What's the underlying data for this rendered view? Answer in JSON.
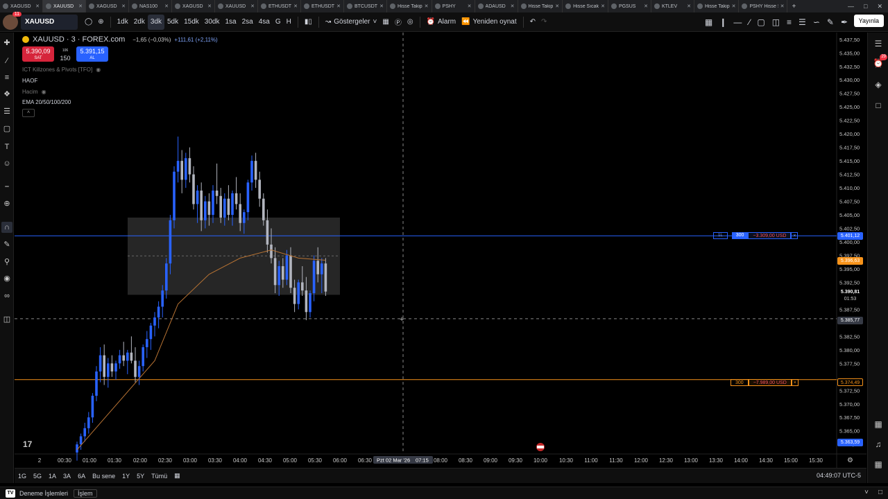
{
  "browser": {
    "tabs": [
      {
        "label": "XAGUSD",
        "active": false
      },
      {
        "label": "XAUUSD",
        "active": true
      },
      {
        "label": "XAGUSD",
        "active": false
      },
      {
        "label": "NAS100",
        "active": false
      },
      {
        "label": "XAGUSD",
        "active": false
      },
      {
        "label": "XAUUSD",
        "active": false
      },
      {
        "label": "ETHUSDT",
        "active": false
      },
      {
        "label": "ETHUSDT",
        "active": false
      },
      {
        "label": "BTCUSDT",
        "active": false
      },
      {
        "label": "Hisse Takip",
        "active": false
      },
      {
        "label": "PSHY",
        "active": false
      },
      {
        "label": "ADAUSD",
        "active": false
      },
      {
        "label": "Hisse Takip",
        "active": false
      },
      {
        "label": "Hisse Sıcak",
        "active": false
      },
      {
        "label": "PGSUS",
        "active": false
      },
      {
        "label": "KTLEV",
        "active": false
      },
      {
        "label": "Hisse Takip",
        "active": false
      },
      {
        "label": "PSHY Hisse Se",
        "active": false
      }
    ],
    "new_tab": "+"
  },
  "toolbar": {
    "notifications": "11",
    "symbol": "XAUUSD",
    "intervals": [
      "1dk",
      "2dk",
      "3dk",
      "5dk",
      "15dk",
      "30dk",
      "1sa",
      "2sa",
      "4sa",
      "G",
      "H"
    ],
    "selected_interval": "3dk",
    "indicators_label": "Göstergeler",
    "alarm_label": "Alarm",
    "replay_label": "Yeniden oynat",
    "publish_label": "Yayınla"
  },
  "legend": {
    "title": "XAUUSD · 3 · FOREX.com",
    "change": "−1,65 (−0,03%)",
    "change2": "+111,61 (+2,11%)",
    "sell_price": "5.390,09",
    "sell_label": "SAT",
    "spread_top": "106",
    "spread_qty": "150",
    "buy_price": "5.391,15",
    "buy_label": "AL",
    "indicator1": "ICT Killzones & Pivots [TFO]",
    "indicator2": "HAOF",
    "indicator3": "Hacim",
    "indicator4": "EMA 20/50/100/200"
  },
  "orders": [
    {
      "side_tag": "1L",
      "qty": "300",
      "pnl": "−3.309,00 USD",
      "close": "×",
      "price_tag": "5.401,12",
      "color": "#2962ff"
    },
    {
      "qty": "300",
      "pnl": "−7.989,00 USD",
      "close": "×",
      "price_tag": "5.374,49",
      "color": "#f7931a"
    }
  ],
  "price_axis": {
    "ticks": [
      "5.437,50",
      "5.435,00",
      "5.432,50",
      "5.430,00",
      "5.427,50",
      "5.425,00",
      "5.422,50",
      "5.420,00",
      "5.417,50",
      "5.415,00",
      "5.412,50",
      "5.410,00",
      "5.407,50",
      "5.405,00",
      "5.402,50",
      "5.400,00",
      "5.397,50",
      "5.395,00",
      "5.392,50",
      "5.387,50",
      "5.382,50",
      "5.380,00",
      "5.377,50",
      "5.372,50",
      "5.370,00",
      "5.367,50",
      "5.365,00",
      "5.362,50"
    ],
    "ema_tag": "5.396,63",
    "last_price": "5.390,81",
    "countdown": "01:53",
    "crosshair_price": "5.385,77",
    "low_tag": "5.363,59"
  },
  "time_axis": {
    "labels": [
      "2",
      "00:30",
      "01:00",
      "01:30",
      "02:00",
      "02:30",
      "03:00",
      "03:30",
      "04:00",
      "04:30",
      "05:00",
      "05:30",
      "06:00",
      "06:30",
      "08:00",
      "08:30",
      "09:00",
      "09:30",
      "10:00",
      "10:30",
      "11:00",
      "11:30",
      "12:00",
      "12:30",
      "13:00",
      "13:30",
      "14:00",
      "14:30",
      "15:00",
      "15:30"
    ],
    "crosshair_date": "Pzt 02 Mar '26",
    "crosshair_time": "07:15"
  },
  "range_bar": {
    "ranges": [
      "1G",
      "5G",
      "1A",
      "3A",
      "6A",
      "Bu sene",
      "1Y",
      "5Y",
      "Tümü"
    ],
    "clock": "04:49:07 UTC-5"
  },
  "bottom_bar": {
    "tab1": "Deneme İşlemleri",
    "tab2": "İşlem"
  },
  "colors": {
    "up": "#2962ff",
    "down": "#b2b5be",
    "ema": "#b87333",
    "box": "#2a2a2a"
  },
  "chart_data": {
    "type": "candlestick",
    "ylim": [
      5361.5,
      5438.5
    ],
    "time_labels_note": "",
    "candles": [
      [
        5361.0,
        5363.0,
        5359.5,
        5362.5
      ],
      [
        5362.5,
        5364.5,
        5361.5,
        5364.0
      ],
      [
        5364.0,
        5366.5,
        5363.0,
        5365.5
      ],
      [
        5365.5,
        5368.5,
        5364.5,
        5367.5
      ],
      [
        5367.5,
        5372.0,
        5366.5,
        5371.5
      ],
      [
        5371.5,
        5377.0,
        5370.5,
        5376.0
      ],
      [
        5376.0,
        5380.5,
        5374.0,
        5379.0
      ],
      [
        5379.0,
        5381.0,
        5373.5,
        5375.0
      ],
      [
        5375.0,
        5378.5,
        5373.0,
        5377.5
      ],
      [
        5377.5,
        5379.0,
        5375.0,
        5376.0
      ],
      [
        5376.0,
        5378.0,
        5374.5,
        5377.5
      ],
      [
        5377.5,
        5380.0,
        5376.5,
        5379.0
      ],
      [
        5379.0,
        5381.5,
        5377.0,
        5378.0
      ],
      [
        5378.0,
        5380.0,
        5375.5,
        5379.5
      ],
      [
        5379.5,
        5382.5,
        5377.5,
        5378.0
      ],
      [
        5378.0,
        5380.5,
        5374.0,
        5375.0
      ],
      [
        5375.0,
        5378.0,
        5373.5,
        5377.0
      ],
      [
        5377.0,
        5381.0,
        5376.0,
        5380.5
      ],
      [
        5380.5,
        5383.5,
        5378.5,
        5382.0
      ],
      [
        5382.0,
        5385.0,
        5380.0,
        5384.5
      ],
      [
        5384.5,
        5387.0,
        5382.5,
        5386.0
      ],
      [
        5386.0,
        5389.0,
        5384.0,
        5388.0
      ],
      [
        5388.0,
        5392.0,
        5386.0,
        5391.0
      ],
      [
        5391.0,
        5397.0,
        5389.5,
        5396.0
      ],
      [
        5396.0,
        5405.0,
        5394.0,
        5404.0
      ],
      [
        5404.0,
        5414.0,
        5402.5,
        5413.0
      ],
      [
        5413.0,
        5419.5,
        5411.0,
        5415.0
      ],
      [
        5415.0,
        5417.0,
        5409.0,
        5411.5
      ],
      [
        5411.5,
        5416.5,
        5410.0,
        5415.5
      ],
      [
        5415.5,
        5417.5,
        5411.0,
        5412.5
      ],
      [
        5412.5,
        5414.0,
        5406.0,
        5407.0
      ],
      [
        5407.0,
        5410.5,
        5403.5,
        5409.5
      ],
      [
        5409.5,
        5411.0,
        5402.0,
        5404.0
      ],
      [
        5404.0,
        5408.5,
        5402.5,
        5407.5
      ],
      [
        5407.5,
        5409.0,
        5403.0,
        5405.0
      ],
      [
        5405.0,
        5410.5,
        5403.5,
        5409.5
      ],
      [
        5409.5,
        5414.5,
        5407.0,
        5408.5
      ],
      [
        5408.5,
        5410.0,
        5403.5,
        5404.5
      ],
      [
        5404.5,
        5409.0,
        5403.0,
        5408.0
      ],
      [
        5408.0,
        5410.5,
        5404.0,
        5405.0
      ],
      [
        5405.0,
        5409.5,
        5403.0,
        5409.0
      ],
      [
        5409.0,
        5412.0,
        5406.0,
        5407.0
      ],
      [
        5407.0,
        5409.0,
        5402.0,
        5403.5
      ],
      [
        5403.5,
        5406.0,
        5401.5,
        5405.5
      ],
      [
        5405.5,
        5411.5,
        5404.0,
        5411.0
      ],
      [
        5411.0,
        5416.0,
        5409.5,
        5415.0
      ],
      [
        5415.0,
        5416.5,
        5410.0,
        5411.5
      ],
      [
        5411.5,
        5413.0,
        5406.5,
        5408.0
      ],
      [
        5408.0,
        5409.0,
        5403.0,
        5404.0
      ],
      [
        5404.0,
        5406.0,
        5398.0,
        5399.5
      ],
      [
        5399.5,
        5402.5,
        5396.0,
        5397.0
      ],
      [
        5397.0,
        5399.0,
        5390.5,
        5392.0
      ],
      [
        5392.0,
        5396.5,
        5390.0,
        5395.5
      ],
      [
        5395.5,
        5397.0,
        5391.5,
        5393.0
      ],
      [
        5393.0,
        5398.5,
        5392.0,
        5397.5
      ],
      [
        5397.5,
        5399.0,
        5390.5,
        5391.5
      ],
      [
        5391.5,
        5393.0,
        5387.0,
        5388.5
      ],
      [
        5388.5,
        5393.0,
        5387.5,
        5392.5
      ],
      [
        5392.5,
        5395.5,
        5390.0,
        5391.0
      ],
      [
        5391.0,
        5393.5,
        5385.5,
        5387.0
      ],
      [
        5387.0,
        5391.0,
        5386.0,
        5390.5
      ],
      [
        5390.5,
        5397.5,
        5389.0,
        5396.5
      ],
      [
        5396.5,
        5399.0,
        5392.5,
        5394.0
      ],
      [
        5394.0,
        5397.0,
        5390.5,
        5396.0
      ],
      [
        5396.0,
        5397.0,
        5390.0,
        5390.8
      ]
    ],
    "ema": [
      [
        0,
        5361.5
      ],
      [
        20,
        5378.0
      ],
      [
        26,
        5388.5
      ],
      [
        34,
        5394.0
      ],
      [
        42,
        5397.0
      ],
      [
        50,
        5398.5
      ],
      [
        57,
        5397.0
      ],
      [
        64,
        5396.6
      ]
    ]
  }
}
